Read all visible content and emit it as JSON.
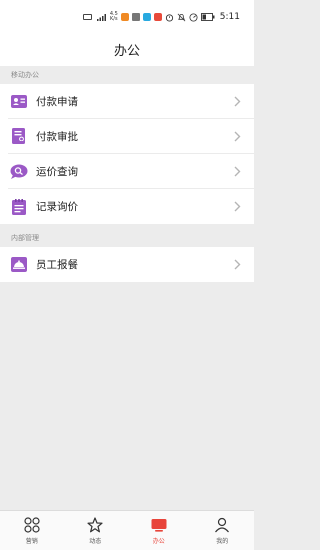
{
  "status_bar": {
    "network": "4.5\nK/s",
    "time": "5:11",
    "icons": [
      "hd-icon",
      "signal-4g-icon",
      "app-notification-icons",
      "alarm-icon",
      "mute-icon",
      "speed-icon",
      "battery-icon"
    ],
    "battery_level": "35"
  },
  "header": {
    "title": "办公"
  },
  "sections": [
    {
      "label": "移动办公",
      "items": [
        {
          "label": "付款申请",
          "icon": "id-card-icon"
        },
        {
          "label": "付款审批",
          "icon": "approval-icon"
        },
        {
          "label": "运价查询",
          "icon": "chat-search-icon"
        },
        {
          "label": "记录询价",
          "icon": "notepad-icon"
        }
      ]
    },
    {
      "label": "内部管理",
      "items": [
        {
          "label": "员工报餐",
          "icon": "meal-cloche-icon"
        }
      ]
    }
  ],
  "tabbar": {
    "tabs": [
      {
        "label": "营销",
        "icon": "grid-icon",
        "active": false
      },
      {
        "label": "动态",
        "icon": "star-icon",
        "active": false
      },
      {
        "label": "办公",
        "icon": "monitor-icon",
        "active": true
      },
      {
        "label": "我的",
        "icon": "person-icon",
        "active": false
      }
    ]
  },
  "colors": {
    "accent_purple": "#9b59c6",
    "active_red": "#e8443a",
    "chevron": "#b5b5b5"
  }
}
